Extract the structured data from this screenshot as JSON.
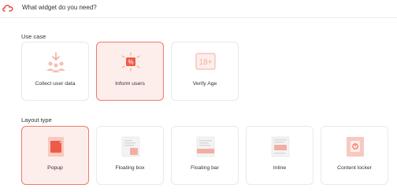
{
  "header": {
    "title": "What widget do you need?"
  },
  "use_case": {
    "label": "Use case",
    "options": [
      {
        "label": "Collect user data",
        "icon": "users-download-icon",
        "selected": false
      },
      {
        "label": "Inform users",
        "icon": "percent-badge-icon",
        "selected": true
      },
      {
        "label": "Verify Age",
        "icon": "age-18-plus-icon",
        "selected": false
      }
    ]
  },
  "layout_type": {
    "label": "Layout type",
    "options": [
      {
        "label": "Popup",
        "icon": "popup-icon",
        "selected": true
      },
      {
        "label": "Floating box",
        "icon": "floating-box-icon",
        "selected": false
      },
      {
        "label": "Floating bar",
        "icon": "floating-bar-icon",
        "selected": false
      },
      {
        "label": "Inline",
        "icon": "inline-icon",
        "selected": false
      },
      {
        "label": "Content locker",
        "icon": "content-locker-icon",
        "selected": false
      }
    ]
  },
  "colors": {
    "accent": "#ee5a45",
    "accent_light": "#f8c9c1",
    "selected_bg": "#fdeeeb",
    "selected_border": "#ee7b6d"
  }
}
